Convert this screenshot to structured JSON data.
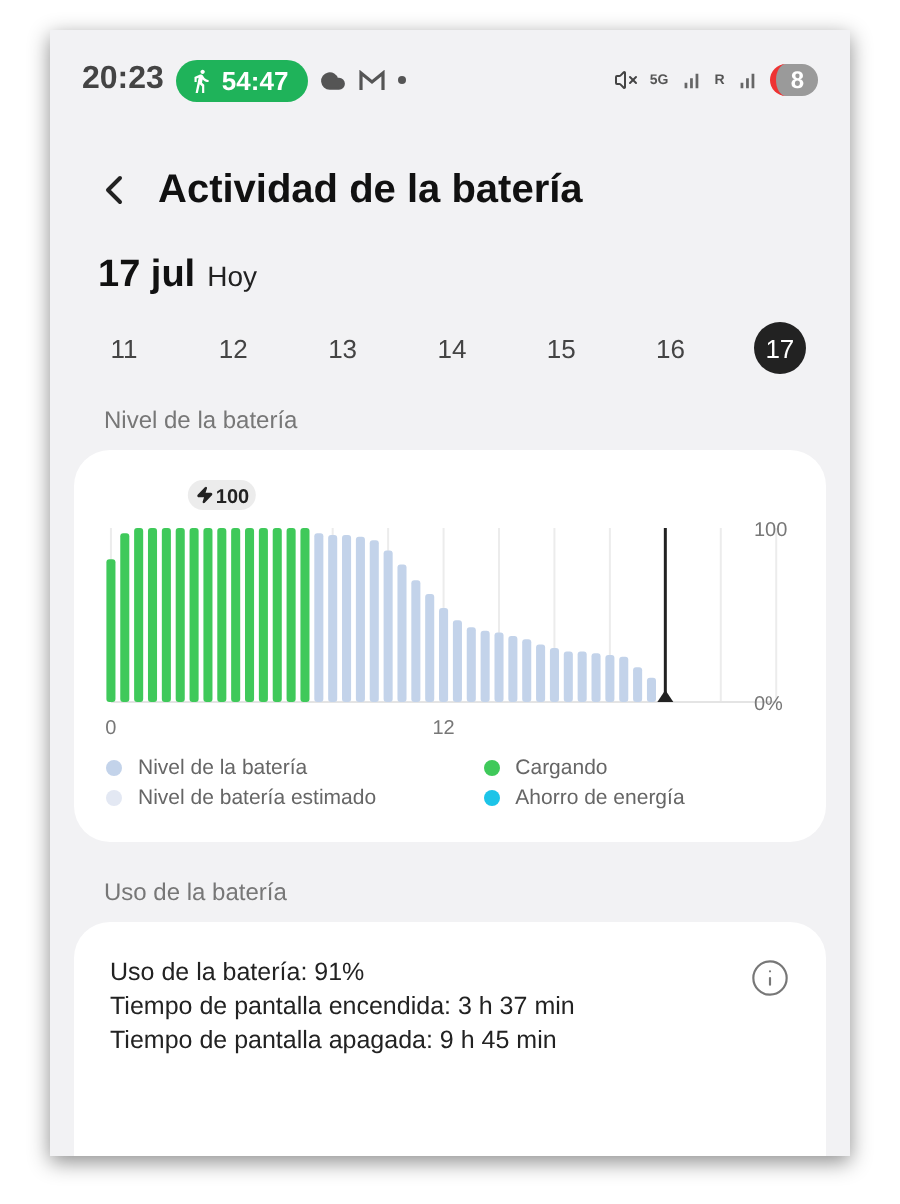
{
  "status_bar": {
    "time": "20:23",
    "activity_timer": "54:47",
    "network": "5G",
    "roaming": "R",
    "battery": "8"
  },
  "header": {
    "title": "Actividad de la batería"
  },
  "date": {
    "day": "17 jul",
    "relative": "Hoy"
  },
  "days": [
    {
      "label": "11",
      "selected": false
    },
    {
      "label": "12",
      "selected": false
    },
    {
      "label": "13",
      "selected": false
    },
    {
      "label": "14",
      "selected": false
    },
    {
      "label": "15",
      "selected": false
    },
    {
      "label": "16",
      "selected": false
    },
    {
      "label": "17",
      "selected": true
    }
  ],
  "battery_level": {
    "heading": "Nivel de la batería",
    "chart_data": {
      "type": "bar",
      "x": [
        0,
        0.5,
        1,
        1.5,
        2,
        2.5,
        3,
        3.5,
        4,
        4.5,
        5,
        5.5,
        6,
        6.5,
        7,
        7.5,
        8,
        8.5,
        9,
        9.5,
        10,
        10.5,
        11,
        11.5,
        12,
        12.5,
        13,
        13.5,
        14,
        14.5,
        15,
        15.5,
        16,
        16.5,
        17,
        17.5,
        18,
        18.5,
        19,
        19.5
      ],
      "series": [
        {
          "name": "Nivel de la batería",
          "color": "#c3d3ea",
          "values": [
            null,
            null,
            null,
            null,
            null,
            null,
            null,
            null,
            null,
            null,
            null,
            null,
            null,
            null,
            null,
            97,
            96,
            96,
            95,
            93,
            87,
            79,
            70,
            62,
            54,
            47,
            43,
            41,
            40,
            38,
            36,
            33,
            31,
            29,
            29,
            28,
            27,
            26,
            20,
            14
          ]
        },
        {
          "name": "Cargando",
          "color": "#3fc95a",
          "values": [
            82,
            97,
            100,
            100,
            100,
            100,
            100,
            100,
            100,
            100,
            100,
            100,
            100,
            100,
            100,
            null,
            null,
            null,
            null,
            null,
            null,
            null,
            null,
            null,
            null,
            null,
            null,
            null,
            null,
            null,
            null,
            null,
            null,
            null,
            null,
            null,
            null,
            null,
            null,
            null
          ]
        }
      ],
      "ylim": [
        0,
        100
      ],
      "yticks": [
        {
          "value": 0,
          "label": "0%"
        },
        {
          "value": 100,
          "label": "100"
        }
      ],
      "xlim": [
        0,
        24
      ],
      "xticks": [
        0,
        12
      ],
      "ref_lines": [
        {
          "axis": "x",
          "value": 20
        }
      ],
      "annotations": [
        "100"
      ]
    },
    "legend_extra": [
      {
        "label": "Nivel de batería estimado",
        "color": "#e3e8f3"
      },
      {
        "label": "Ahorro de energía",
        "color": "#1cc4e8"
      }
    ]
  },
  "battery_usage": {
    "heading": "Uso de la batería",
    "lines": [
      "Uso de la batería: 91%",
      "Tiempo de pantalla encendida: 3 h 37 min",
      "Tiempo de pantalla apagada: 9 h 45 min"
    ]
  }
}
